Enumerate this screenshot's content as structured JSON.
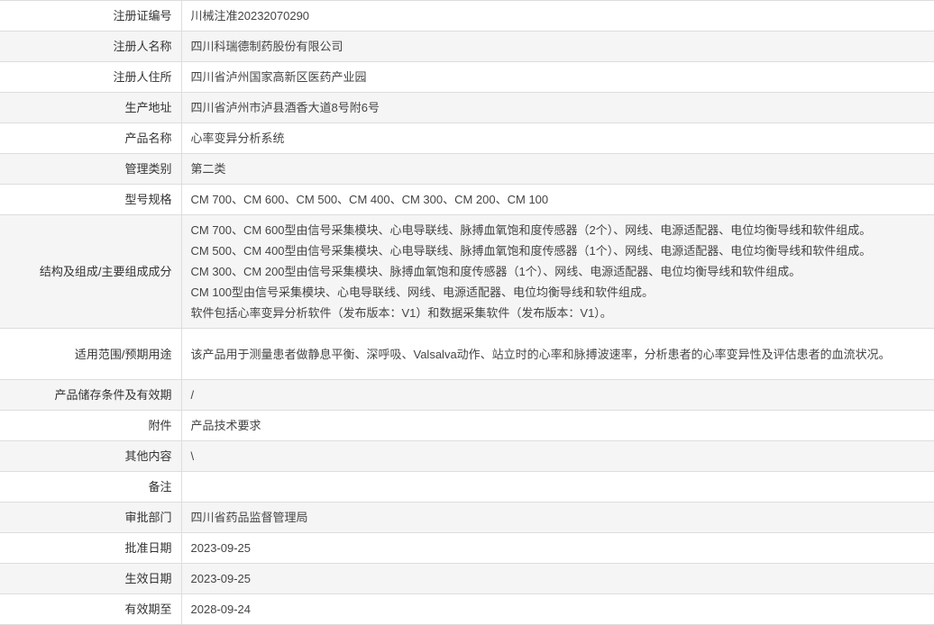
{
  "rows": {
    "registration_no": {
      "label": "注册证编号",
      "value": "川械注准20232070290"
    },
    "registrant_name": {
      "label": "注册人名称",
      "value": "四川科瑞德制药股份有限公司"
    },
    "registrant_address": {
      "label": "注册人住所",
      "value": "四川省泸州国家高新区医药产业园"
    },
    "production_address": {
      "label": "生产地址",
      "value": "四川省泸州市泸县酒香大道8号附6号"
    },
    "product_name": {
      "label": "产品名称",
      "value": "心率变异分析系统"
    },
    "management_class": {
      "label": "管理类别",
      "value": "第二类"
    },
    "model_spec": {
      "label": "型号规格",
      "value": "CM 700、CM 600、CM 500、CM 400、CM 300、CM 200、CM 100"
    },
    "structure": {
      "label": "结构及组成/主要组成成分",
      "lines": [
        "CM 700、CM 600型由信号采集模块、心电导联线、脉搏血氧饱和度传感器（2个）、网线、电源适配器、电位均衡导线和软件组成。",
        "CM 500、CM 400型由信号采集模块、心电导联线、脉搏血氧饱和度传感器（1个）、网线、电源适配器、电位均衡导线和软件组成。",
        "CM 300、CM 200型由信号采集模块、脉搏血氧饱和度传感器（1个）、网线、电源适配器、电位均衡导线和软件组成。",
        "CM 100型由信号采集模块、心电导联线、网线、电源适配器、电位均衡导线和软件组成。",
        "软件包括心率变异分析软件（发布版本：V1）和数据采集软件（发布版本：V1）。"
      ]
    },
    "intended_use": {
      "label": "适用范围/预期用途",
      "value": "该产品用于测量患者做静息平衡、深呼吸、Valsalva动作、站立时的心率和脉搏波速率，分析患者的心率变异性及评估患者的血流状况。"
    },
    "storage": {
      "label": "产品储存条件及有效期",
      "value": "/"
    },
    "attachment": {
      "label": "附件",
      "value": "产品技术要求"
    },
    "other": {
      "label": "其他内容",
      "value": "\\"
    },
    "remarks": {
      "label": "备注",
      "value": ""
    },
    "approval_dept": {
      "label": "审批部门",
      "value": "四川省药品监督管理局"
    },
    "approval_date": {
      "label": "批准日期",
      "value": "2023-09-25"
    },
    "effective_date": {
      "label": "生效日期",
      "value": "2023-09-25"
    },
    "valid_until": {
      "label": "有效期至",
      "value": "2028-09-24"
    }
  }
}
